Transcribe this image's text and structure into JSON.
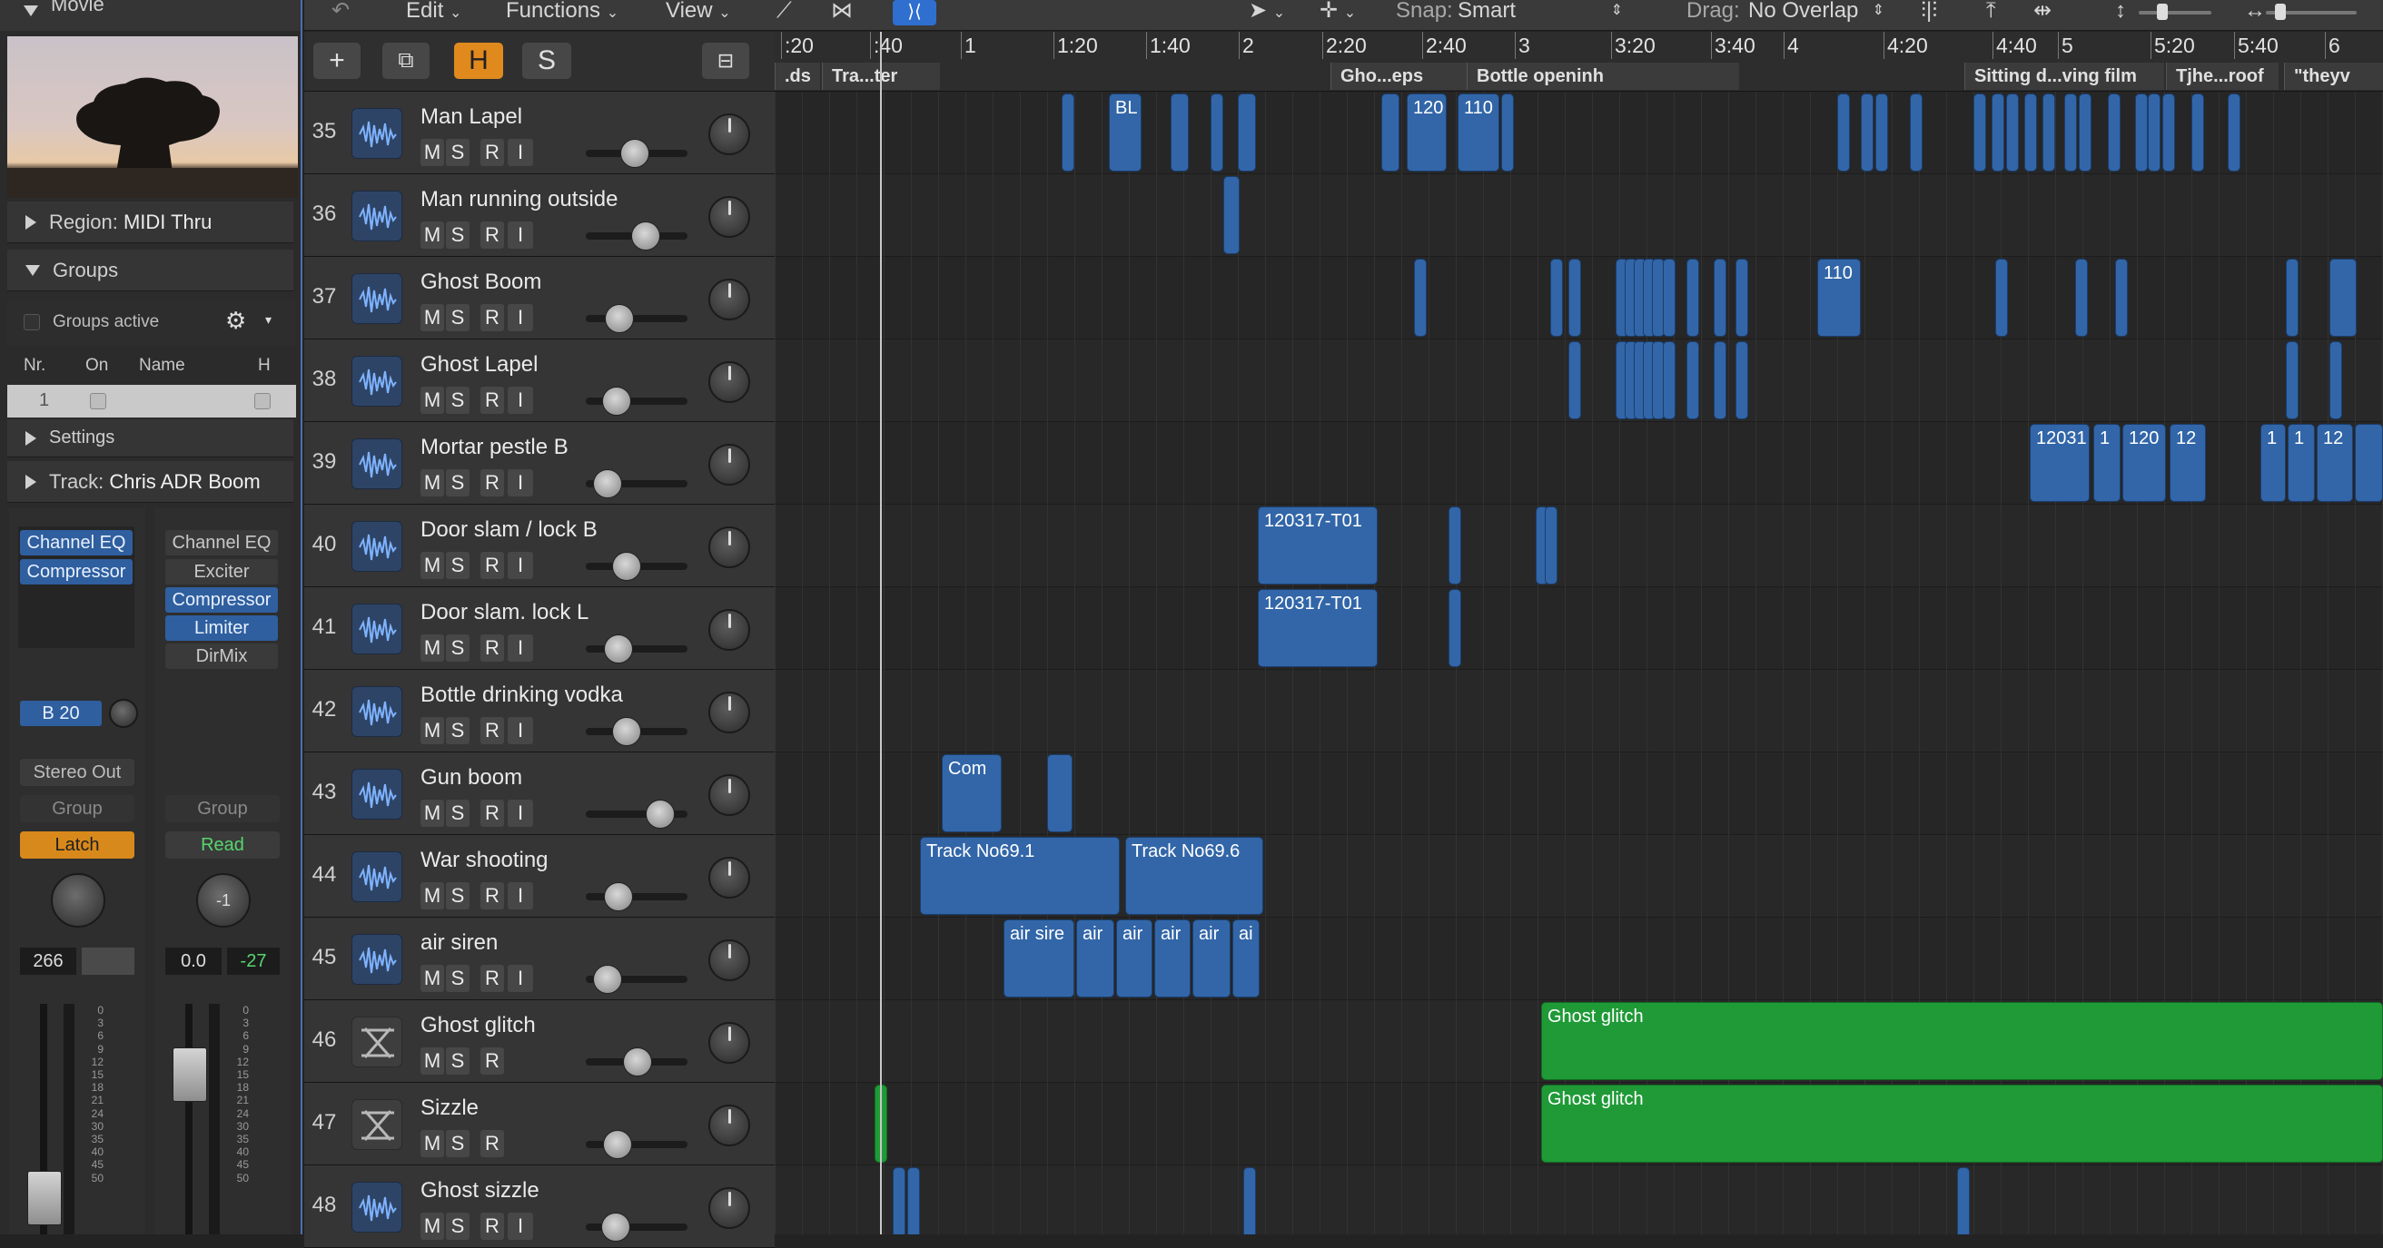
{
  "inspector": {
    "movie_label": "Movie",
    "region_label": "Region:",
    "region_value": "MIDI Thru",
    "groups_label": "Groups",
    "groups_active": "Groups active",
    "groups_cols": [
      "Nr.",
      "On",
      "Name",
      "H"
    ],
    "groups_row_nr": "1",
    "settings_label": "Settings",
    "track_label": "Track:",
    "track_value": "Chris ADR Boom",
    "strip1": {
      "plugins": [
        "Channel EQ",
        "Compressor"
      ],
      "send": "B 20",
      "output": "Stereo Out",
      "group": "Group",
      "automation": "Latch",
      "value1": "266",
      "value2": ""
    },
    "strip2": {
      "plugins": [
        "Channel EQ",
        "Exciter",
        "Compressor",
        "Limiter",
        "DirMix"
      ],
      "group": "Group",
      "automation": "Read",
      "pan_value": "-1",
      "value1": "0.0",
      "value2": "-27"
    },
    "meter_scale": [
      "0",
      "3",
      "6",
      "9",
      "12",
      "15",
      "18",
      "21",
      "24",
      "30",
      "35",
      "40",
      "45",
      "50"
    ]
  },
  "toolbar": {
    "menus": [
      "Edit",
      "Functions",
      "View"
    ],
    "snap_label": "Snap:",
    "snap_value": "Smart",
    "drag_label": "Drag:",
    "drag_value": "No Overlap"
  },
  "list_header": {
    "add": "+",
    "h_label": "H",
    "s_label": "S"
  },
  "ruler": {
    "ticks": [
      ":20",
      ":40",
      "1",
      "1:20",
      "1:40",
      "2",
      "2:20",
      "2:40",
      "3",
      "3:20",
      "3:40",
      "4",
      "4:20",
      "4:40",
      "5",
      "5:20",
      "5:40",
      "6"
    ],
    "markers": [
      ".ds",
      "Tra...ter",
      "Gho...eps",
      "Bottle openinh",
      "Sitting d...ving film",
      "Tjhe...roof",
      "\"theyv"
    ]
  },
  "tracks": [
    {
      "num": "35",
      "name": "Man Lapel",
      "type": "audio",
      "buttons": [
        "M",
        "S",
        "R",
        "I"
      ],
      "fader": 0.45
    },
    {
      "num": "36",
      "name": "Man running outside",
      "type": "audio",
      "buttons": [
        "M",
        "S",
        "R",
        "I"
      ],
      "fader": 0.6
    },
    {
      "num": "37",
      "name": "Ghost Boom",
      "type": "audio",
      "buttons": [
        "M",
        "S",
        "R",
        "I"
      ],
      "fader": 0.25
    },
    {
      "num": "38",
      "name": "Ghost Lapel",
      "type": "audio",
      "buttons": [
        "M",
        "S",
        "R",
        "I"
      ],
      "fader": 0.22
    },
    {
      "num": "39",
      "name": "Mortar pestle B",
      "type": "audio",
      "buttons": [
        "M",
        "S",
        "R",
        "I"
      ],
      "fader": 0.1
    },
    {
      "num": "40",
      "name": "Door slam / lock B",
      "type": "audio",
      "buttons": [
        "M",
        "S",
        "R",
        "I"
      ],
      "fader": 0.35
    },
    {
      "num": "41",
      "name": "Door slam. lock L",
      "type": "audio",
      "buttons": [
        "M",
        "S",
        "R",
        "I"
      ],
      "fader": 0.24
    },
    {
      "num": "42",
      "name": "Bottle drinking vodka",
      "type": "audio",
      "buttons": [
        "M",
        "S",
        "R",
        "I"
      ],
      "fader": 0.34
    },
    {
      "num": "43",
      "name": "Gun boom",
      "type": "audio",
      "buttons": [
        "M",
        "S",
        "R",
        "I"
      ],
      "fader": 0.78
    },
    {
      "num": "44",
      "name": "War shooting",
      "type": "audio",
      "buttons": [
        "M",
        "S",
        "R",
        "I"
      ],
      "fader": 0.24
    },
    {
      "num": "45",
      "name": "air siren",
      "type": "audio",
      "buttons": [
        "M",
        "S",
        "R",
        "I"
      ],
      "fader": 0.1
    },
    {
      "num": "46",
      "name": "Ghost glitch",
      "type": "instrument",
      "buttons": [
        "M",
        "S",
        "R"
      ],
      "fader": 0.49
    },
    {
      "num": "47",
      "name": "Sizzle",
      "type": "instrument",
      "buttons": [
        "M",
        "S",
        "R"
      ],
      "fader": 0.23
    },
    {
      "num": "48",
      "name": "Ghost sizzle",
      "type": "audio",
      "buttons": [
        "M",
        "S",
        "R",
        "I"
      ],
      "fader": 0.2
    }
  ],
  "regions": {
    "r35_bl": "BL",
    "r35_120": "120",
    "r35_110": "110",
    "r37_110": "110",
    "r39_a": "12031",
    "r39_b": "1",
    "r39_c": "120",
    "r39_d": "12",
    "r39_e": "1",
    "r39_f": "1",
    "r39_g": "12",
    "r40": "120317-T01",
    "r41": "120317-T01",
    "r43": "Com",
    "r44_a": "Track No69.1",
    "r44_b": "Track No69.6",
    "r45": [
      "air sire",
      "air",
      "air",
      "air",
      "air",
      "ai"
    ],
    "r46": "Ghost glitch",
    "r47": "Ghost glitch"
  },
  "colors": {
    "audio_region": "#3266a8",
    "midi_region": "#1f9a37",
    "accent": "#f0a030",
    "selection": "#4d6fae"
  }
}
